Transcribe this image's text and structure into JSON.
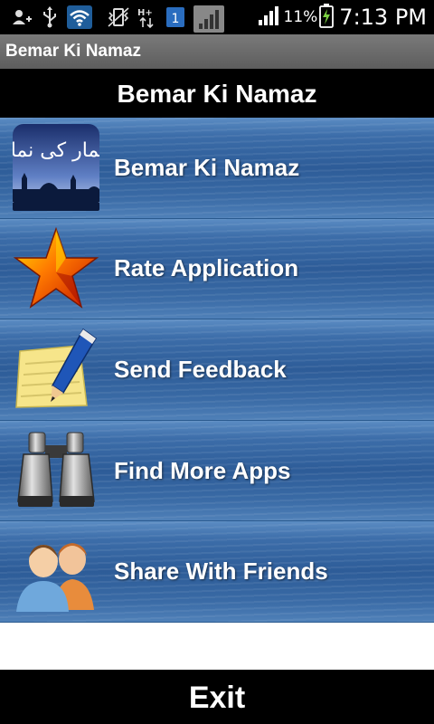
{
  "status_bar": {
    "battery_percent": "11%",
    "time": "7:13 PM",
    "notification_badge": "1",
    "network_type": "H+",
    "icons": [
      "person-add-icon",
      "usb-icon",
      "wifi-icon",
      "vibrate-icon",
      "network-activity-icon",
      "sim-badge-icon",
      "signal-icon",
      "signal-icon",
      "battery-charging-icon"
    ]
  },
  "window_title": "Bemar Ki Namaz",
  "header": {
    "title": "Bemar Ki Namaz"
  },
  "menu": {
    "items": [
      {
        "label": "Bemar Ki Namaz",
        "icon": "mosque-book-icon",
        "icon_text": "بیمار کی نماز"
      },
      {
        "label": "Rate Application",
        "icon": "star-icon"
      },
      {
        "label": "Send Feedback",
        "icon": "notepad-pencil-icon"
      },
      {
        "label": "Find More Apps",
        "icon": "binoculars-icon"
      },
      {
        "label": "Share With Friends",
        "icon": "users-icon"
      }
    ]
  },
  "footer": {
    "exit_label": "Exit"
  },
  "colors": {
    "menu_blue": "#2d5c98",
    "bar_black": "#000000",
    "title_gray": "#6a6a6a"
  }
}
